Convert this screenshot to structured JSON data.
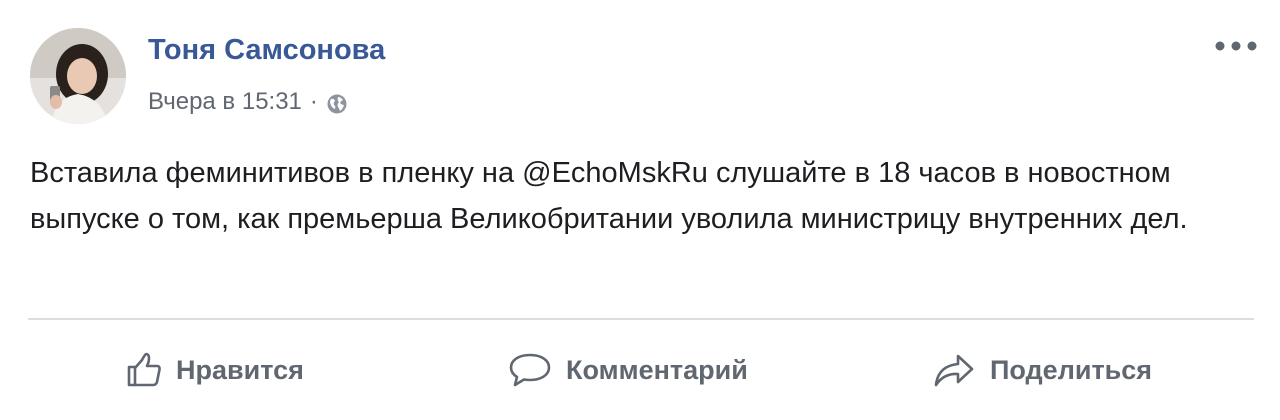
{
  "post": {
    "author": "Тоня Самсонова",
    "timestamp": "Вчера в 15:31",
    "separator": "·",
    "privacy_icon": "globe-icon",
    "more_icon": "more-dots-icon",
    "text": "Вставила феминитивов в пленку на @EchoMskRu слушайте в 18 часов в новостном выпуске о том, как премьерша Великобритании уволила министрицу внутренних дел."
  },
  "actions": {
    "like": {
      "label": "Нравится",
      "icon": "thumbs-up-icon"
    },
    "comment": {
      "label": "Комментарий",
      "icon": "comment-bubble-icon"
    },
    "share": {
      "label": "Поделиться",
      "icon": "share-arrow-icon"
    }
  },
  "colors": {
    "author_link": "#385898",
    "meta_text": "#616770",
    "body_text": "#1c1e21",
    "action_text": "#606770",
    "divider": "#dadde1"
  }
}
